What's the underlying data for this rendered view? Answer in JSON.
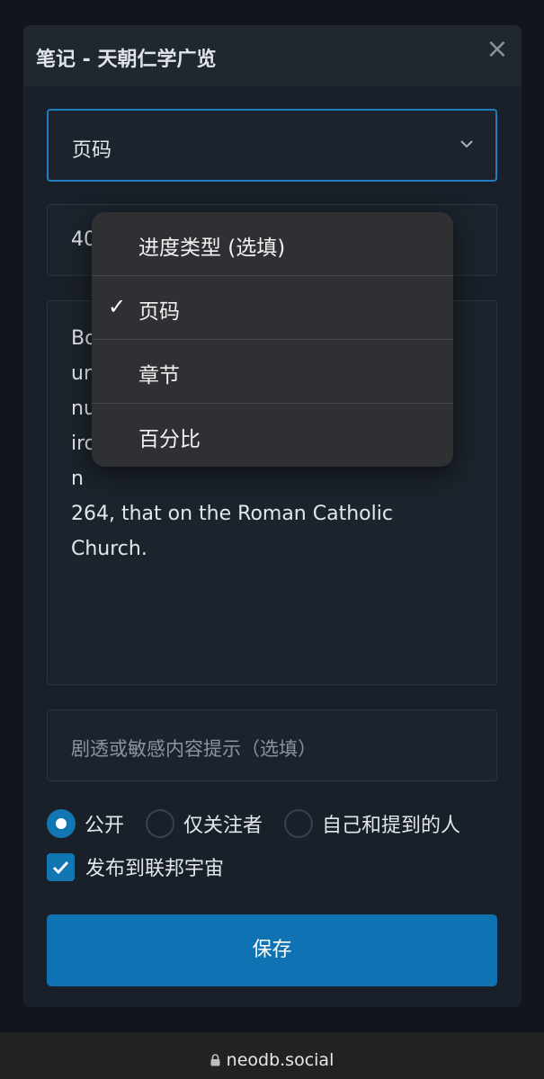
{
  "modal": {
    "title": "笔记 - 天朝仁学广览",
    "close_label": "×"
  },
  "progress_type_select": {
    "value": "页码"
  },
  "progress_input": {
    "value": "40"
  },
  "note": {
    "text": "Bo\nur\nnu\niro                                                              n\n264, that on the Roman Catholic\nChurch."
  },
  "spoiler": {
    "placeholder": "剧透或敏感内容提示（选填）"
  },
  "visibility": {
    "options": [
      "公开",
      "仅关注者",
      "自己和提到的人"
    ],
    "selected": "公开"
  },
  "federate": {
    "label": "发布到联邦宇宙",
    "checked": true
  },
  "save_button": {
    "label": "保存"
  },
  "dropdown": {
    "items": [
      {
        "label": "进度类型 (选填)",
        "mark": ""
      },
      {
        "label": "页码",
        "mark": "✓"
      },
      {
        "label": "章节",
        "mark": ""
      },
      {
        "label": "百分比",
        "mark": ""
      }
    ],
    "selected": "页码"
  },
  "browser": {
    "url": "neodb.social"
  },
  "colors": {
    "accent": "#1276b3",
    "modal_bg": "#1a2029",
    "dropdown_bg": "#2e3033"
  }
}
